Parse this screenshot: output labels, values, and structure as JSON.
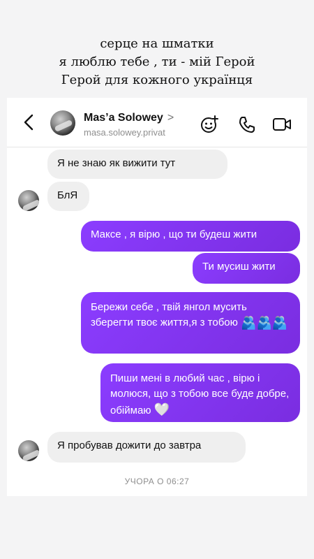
{
  "caption": {
    "line1": "серце  на  шматки",
    "line2": "я люблю тебе , ти - мій Герой",
    "line3": "Герой для кожного українця"
  },
  "header": {
    "name": "Mas’a Solowey",
    "name_chevron": ">",
    "handle": "masa.solowey.privat",
    "icons": [
      "back-arrow-icon",
      "effects-icon",
      "phone-icon",
      "video-camera-icon"
    ]
  },
  "messages": [
    {
      "side": "in",
      "text": "Я не знаю як вижити тут"
    },
    {
      "side": "in",
      "text": "БлЯ"
    },
    {
      "side": "out",
      "text": "Максе , я вірю , що ти будеш жити"
    },
    {
      "side": "out",
      "text": "Ти мусиш жити"
    },
    {
      "side": "out",
      "text": "Бережи себе , твій янгол мусить зберегти твоє життя,я з тобою",
      "emoji": "🫂🫂🫂"
    },
    {
      "side": "out",
      "text": "Пиши мені в любий час , вірю і молюся, що з тобою все буде добре, обіймаю",
      "emoji": "🤍"
    },
    {
      "side": "in",
      "text": "Я пробував   дожити до завтра"
    }
  ],
  "timestamp": "УЧОРА О 06:27",
  "colors": {
    "outgoing_bubble": "#8b3dff",
    "incoming_bubble": "#efefef",
    "page_background": "#f4f4f5"
  }
}
